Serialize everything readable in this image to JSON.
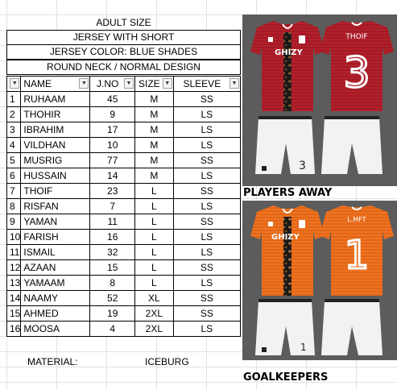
{
  "header": {
    "size_title": "ADULT SIZE",
    "kit_type": "JERSEY WITH SHORT",
    "color": "JERSEY COLOR: BLUE SHADES",
    "design": "ROUND NECK / NORMAL DESIGN"
  },
  "table": {
    "columns": [
      "",
      "NAME",
      "J.NO",
      "SIZE",
      "SLEEVE"
    ],
    "rows": [
      {
        "no": "1",
        "name": "RUHAAM",
        "jno": "45",
        "size": "M",
        "sleeve": "SS"
      },
      {
        "no": "2",
        "name": "THOHIR",
        "jno": "9",
        "size": "M",
        "sleeve": "LS"
      },
      {
        "no": "3",
        "name": "IBRAHIM",
        "jno": "17",
        "size": "M",
        "sleeve": "LS"
      },
      {
        "no": "4",
        "name": "VILDHAN",
        "jno": "10",
        "size": "M",
        "sleeve": "LS"
      },
      {
        "no": "5",
        "name": "MUSRIG",
        "jno": "77",
        "size": "M",
        "sleeve": "SS"
      },
      {
        "no": "6",
        "name": "HUSSAIN",
        "jno": "14",
        "size": "M",
        "sleeve": "LS"
      },
      {
        "no": "7",
        "name": "THOIF",
        "jno": "23",
        "size": "L",
        "sleeve": "SS"
      },
      {
        "no": "8",
        "name": "RISFAN",
        "jno": "7",
        "size": "L",
        "sleeve": "LS"
      },
      {
        "no": "9",
        "name": "YAMAN",
        "jno": "11",
        "size": "L",
        "sleeve": "SS"
      },
      {
        "no": "10",
        "name": "FARISH",
        "jno": "16",
        "size": "L",
        "sleeve": "LS"
      },
      {
        "no": "11",
        "name": "ISMAIL",
        "jno": "32",
        "size": "L",
        "sleeve": "LS"
      },
      {
        "no": "12",
        "name": "AZAAN",
        "jno": "15",
        "size": "L",
        "sleeve": "SS"
      },
      {
        "no": "13",
        "name": "YAMAAM",
        "jno": "8",
        "size": "L",
        "sleeve": "LS"
      },
      {
        "no": "14",
        "name": "NAAMY",
        "jno": "52",
        "size": "XL",
        "sleeve": "SS"
      },
      {
        "no": "15",
        "name": "AHMED",
        "jno": "19",
        "size": "2XL",
        "sleeve": "SS"
      },
      {
        "no": "16",
        "name": "MOOSA",
        "jno": "4",
        "size": "2XL",
        "sleeve": "LS"
      }
    ]
  },
  "material": {
    "label": "MATERIAL:",
    "value": "ICEBURG"
  },
  "images": {
    "away": {
      "title": "PLAYERS AWAY",
      "front_brand": "GHIZY",
      "back_name": "THOIF",
      "back_number": "3",
      "short_number": "3",
      "colors": {
        "shirt": "#b3202c",
        "shirt_dark": "#8e1620",
        "stripe": "#1a1a1a",
        "short": "#f2f2f2"
      }
    },
    "goalkeepers": {
      "title": "GOALKEEPERS",
      "front_brand": "GHIZY",
      "back_name": "L.MFT",
      "back_number": "1",
      "short_number": "1",
      "colors": {
        "shirt": "#f0731e",
        "shirt_dark": "#d85c10",
        "stripe": "#1a1a1a",
        "short": "#f2f2f2"
      }
    }
  },
  "dropdown_icon": "filter-dropdown-icon"
}
